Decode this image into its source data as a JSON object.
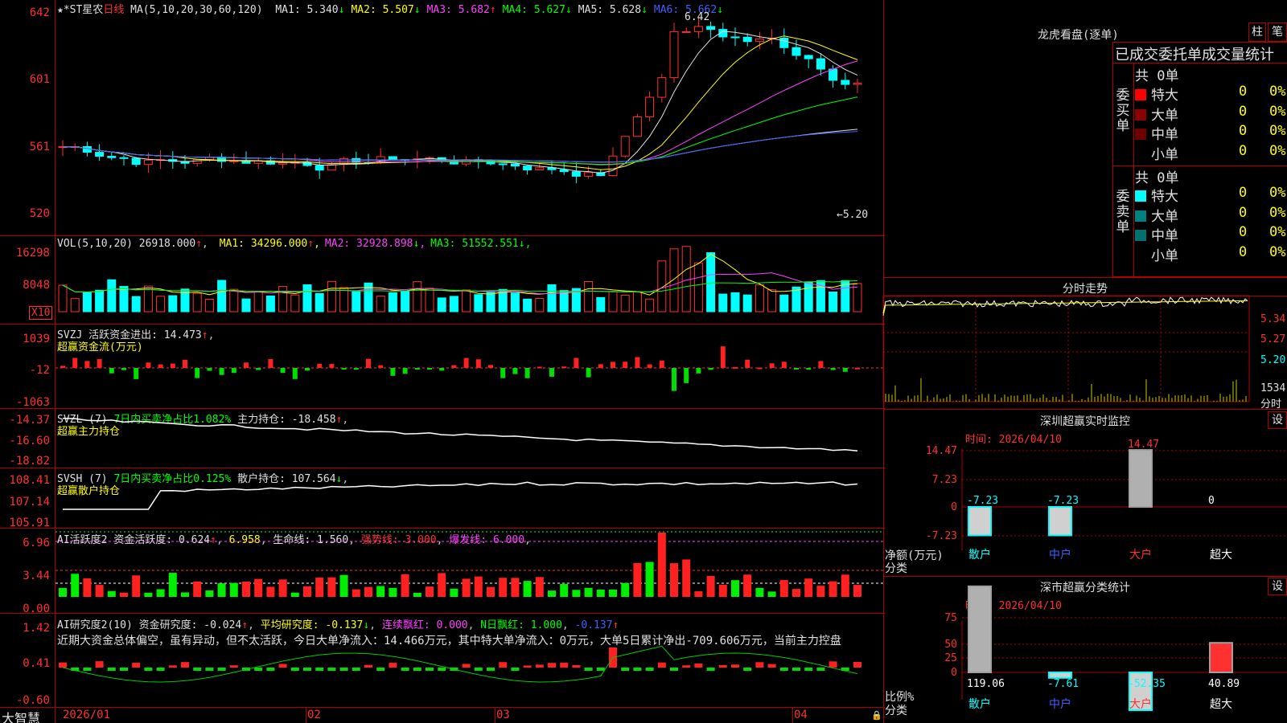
{
  "stock": {
    "name": "★*ST星农",
    "period": "日线",
    "lhb_title": "龙虎看盘(逐单)"
  },
  "main_panel": {
    "ma_label": "MA(5,10,20,30,60,120)",
    "ma": [
      {
        "name": "MA1",
        "value": "5.340",
        "arrow": "↓",
        "color": "#e0e0e0"
      },
      {
        "name": "MA2",
        "value": "5.507",
        "arrow": "↓",
        "color": "#ffff00"
      },
      {
        "name": "MA3",
        "value": "5.682",
        "arrow": "↑",
        "color": "#ff40ff"
      },
      {
        "name": "MA4",
        "value": "5.627",
        "arrow": "↓",
        "color": "#00ff00"
      },
      {
        "name": "MA5",
        "value": "5.628",
        "arrow": "↓",
        "color": "#e0e0e0"
      },
      {
        "name": "MA6",
        "value": "5.662",
        "arrow": "↓",
        "color": "#4060ff"
      }
    ],
    "yticks": [
      "642",
      "601",
      "561",
      "520"
    ],
    "high_label": "6.42",
    "low_label": "←5.20"
  },
  "vol_panel": {
    "label": "VOL(5,10,20)",
    "value": "26918.000",
    "ma": [
      {
        "name": "MA1",
        "value": "34296.000",
        "arrow": "↑",
        "color": "#ffff00"
      },
      {
        "name": "MA2",
        "value": "32928.898",
        "arrow": "↓",
        "color": "#ff40ff"
      },
      {
        "name": "MA3",
        "value": "51552.551",
        "arrow": "↓",
        "color": "#00ff00"
      }
    ],
    "yticks": [
      "16298",
      "8048"
    ],
    "unit": "X10"
  },
  "svzj": {
    "label": "SVZJ",
    "name": "活跃资金进出:",
    "value": "14.473",
    "arrow": "↑",
    "sub": "超赢资金流(万元)",
    "yticks": [
      "1039",
      "-12",
      "-1063"
    ]
  },
  "svzl": {
    "label": "SVZL (7)",
    "desc": "7日内买卖净占比1.082%",
    "name": "主力持仓:",
    "value": "-18.458",
    "arrow": "↑",
    "sub": "超赢主力持仓",
    "yticks": [
      "-14.37",
      "-16.60",
      "-18.82"
    ]
  },
  "svsh": {
    "label": "SVSH (7)",
    "desc": "7日内买卖净占比0.125%",
    "name": "散户持仓:",
    "value": "107.564",
    "arrow": "↓",
    "sub": "超赢散户持仓",
    "yticks": [
      "108.41",
      "107.14",
      "105.91"
    ]
  },
  "ai_active": {
    "label": "AI活跃度2",
    "v1_name": "资金活跃度:",
    "v1": "0.624",
    "a1": "↑",
    "v2": "6.958",
    "v3_name": "生命线:",
    "v3": "1.560",
    "v4_name": "强势线:",
    "v4": "3.000",
    "v5_name": "爆发线:",
    "v5": "6.000",
    "yticks": [
      "6.96",
      "3.44",
      "0.00"
    ]
  },
  "ai_research": {
    "label": "AI研究度2(10)",
    "r1_name": "资金研究度:",
    "r1": "-0.024",
    "ra1": "↑",
    "r2_name": "平均研究度:",
    "r2": "-0.137",
    "ra2": "↓",
    "r3_name": "连续飘红:",
    "r3": "0.000",
    "r4_name": "N日飘红:",
    "r4": "1.000",
    "r5": "-0.137",
    "ra5": "↑",
    "comment": "近期大资金总体偏空，虽有异动，但不太活跃，今日大单净流入：14.466万元，其中特大单净流入：0万元，大单5日累计净出-709.606万元，当前主力控盘",
    "yticks": [
      "1.42",
      "0.41",
      "-0.60"
    ]
  },
  "x_axis": {
    "brand": "大智慧",
    "labels": [
      "2026/01",
      "02",
      "03",
      "04"
    ]
  },
  "right": {
    "btn_col": "柱",
    "btn_pen": "笔",
    "stat_title": "已成交委托单成交量统计",
    "buy": {
      "side": "委买单",
      "total": "共 0单",
      "rows": [
        {
          "name": "特大",
          "count": "0",
          "pct": "0%",
          "color": "#ff0000"
        },
        {
          "name": "大单",
          "count": "0",
          "pct": "0%",
          "color": "#8b0000"
        },
        {
          "name": "中单",
          "count": "0",
          "pct": "0%",
          "color": "#700000"
        },
        {
          "name": "小单",
          "count": "0",
          "pct": "0%",
          "color": "#000000"
        }
      ]
    },
    "sell": {
      "side": "委卖单",
      "total": "共 0单",
      "rows": [
        {
          "name": "特大",
          "count": "0",
          "pct": "0%",
          "color": "#00ffff"
        },
        {
          "name": "大单",
          "count": "0",
          "pct": "0%",
          "color": "#008080"
        },
        {
          "name": "中单",
          "count": "0",
          "pct": "0%",
          "color": "#007070"
        },
        {
          "name": "小单",
          "count": "0",
          "pct": "0%",
          "color": "#000000"
        }
      ]
    },
    "intraday": {
      "title": "分时走势",
      "prices": [
        "5.34",
        "5.27",
        "5.20"
      ],
      "vol": "1534",
      "unit": "分时"
    },
    "monitor": {
      "title": "深圳超赢实时监控",
      "time": "时间: 2026/04/10",
      "btn": "设",
      "yticks": [
        "14.47",
        "7.23",
        "0",
        "-7.23"
      ],
      "ylabel": "净额(万元)",
      "xlabel": "分类",
      "categories": [
        "散户",
        "中户",
        "大户",
        "超大"
      ],
      "values": [
        -7.23,
        -7.23,
        14.47,
        0
      ],
      "labels": [
        "-7.23",
        "-7.23",
        "14.47",
        "0"
      ]
    },
    "classify": {
      "title": "深市超赢分类统计",
      "time": "时间: 2026/04/10",
      "btn": "设",
      "yticks": [
        "75",
        "50",
        "25",
        "0"
      ],
      "ylabel": "比例%",
      "xlabel": "分类",
      "categories": [
        "散户",
        "中户",
        "大户",
        "超大"
      ],
      "values": [
        119.06,
        -7.61,
        -52.35,
        40.89
      ],
      "labels": [
        "119.06",
        "-7.61",
        "-52.35",
        "40.89"
      ]
    }
  }
}
